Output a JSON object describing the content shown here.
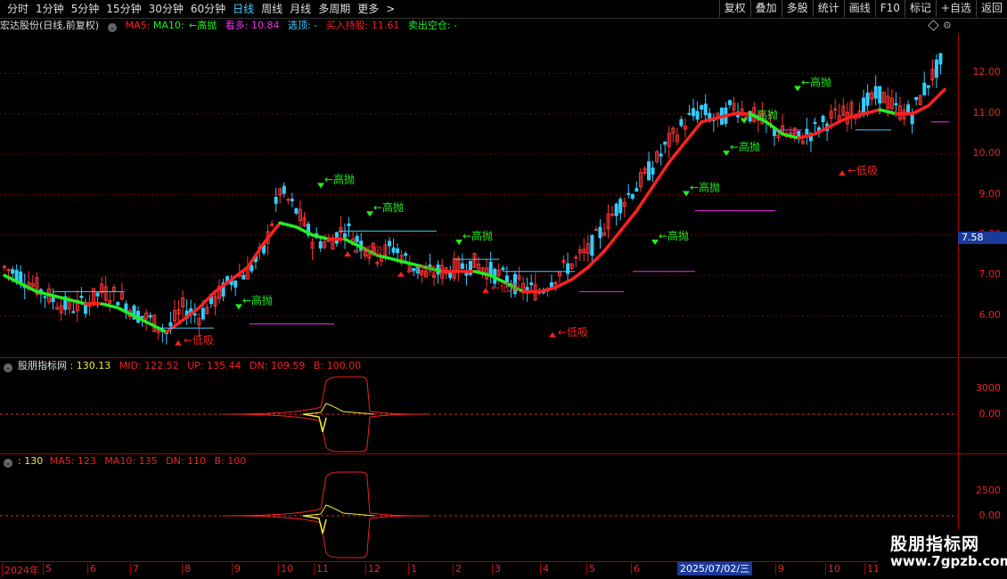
{
  "toolbar": {
    "periods": [
      "分时",
      "1分钟",
      "5分钟",
      "15分钟",
      "30分钟",
      "60分钟",
      "日线",
      "周线",
      "月线",
      "多周期",
      "更多"
    ],
    "active_period": "日线",
    "more_arrow": ">",
    "right_buttons": [
      "复权",
      "叠加",
      "多股",
      "统计",
      "画线",
      "F10",
      "标记",
      "+自选",
      "返回"
    ]
  },
  "main_legend": {
    "stock": "宏达股份(日线,前复权)",
    "ma5": "MA5:",
    "ma10": "MA10:",
    "ma10_val": "←高抛",
    "kanduo": "看多: 10.84",
    "xuanding": "选顶: -",
    "mairu": "买入持股: 11.61",
    "maichu": "卖出空仓: -"
  },
  "price_axis": {
    "ticks": [
      "12.00",
      "11.00",
      "10.00",
      "9.00",
      "8.00",
      "7.00",
      "6.00"
    ],
    "tick_values": [
      12,
      11,
      10,
      9,
      8,
      7,
      6
    ],
    "current_price": "7.58",
    "ymin": 5.0,
    "ymax": 13.0
  },
  "annotations": [
    {
      "text": "←高抛",
      "color": "#2e2",
      "x_idx": 1
    },
    {
      "text": "高抛",
      "color": "#2e2"
    },
    {
      "text": "低吸",
      "color": "#e22"
    }
  ],
  "annot_labels": {
    "high": "高抛",
    "low": "低吸",
    "high_arrow": "←高抛",
    "low_arrow": "←低吸"
  },
  "panel1": {
    "title": "股朋指标网",
    "value": ": 130.13",
    "mid": "MID: 122.52",
    "up": "UP: 135.44",
    "dn": "DN: 109.59",
    "b": "B: 100.00",
    "ticks": [
      "3000",
      "0.00"
    ]
  },
  "panel2": {
    "value": ": 130",
    "ma5": "MA5: 123",
    "ma10": "MA10: 135",
    "dn": "DN: 110",
    "b": "B: 100",
    "ticks": [
      "2500",
      "0.00"
    ]
  },
  "date_axis": {
    "labels": [
      "2024年",
      "5",
      "6",
      "7",
      "8",
      "9",
      "10",
      "11",
      "12",
      "1",
      "2",
      "3",
      "4",
      "5",
      "6",
      "",
      "8",
      "9",
      "10",
      "11"
    ],
    "cursor": "2025/07/02/三"
  },
  "watermark": {
    "title": "股朋指标网",
    "url": "www.7gpzb.com"
  },
  "colors": {
    "up": "#ff3333",
    "down": "#33ccff",
    "ma_red": "#ff2020",
    "ma_green": "#22ee22",
    "grid": "#7a0000",
    "accent": "#1a3a9a"
  },
  "chart_data": {
    "type": "line",
    "title": "",
    "series": [
      {
        "name": "close",
        "values": [
          7.2,
          7.0,
          6.7,
          6.4,
          6.2,
          6.3,
          6.6,
          6.5,
          6.1,
          5.9,
          5.6,
          6.2,
          6.0,
          6.4,
          6.9,
          7.1,
          7.6,
          9.1,
          8.6,
          7.9,
          7.8,
          8.2,
          7.8,
          7.5,
          7.7,
          7.3,
          7.0,
          7.1,
          7.2,
          7.3,
          7.1,
          6.9,
          6.7,
          6.6,
          7.0,
          7.3,
          7.6,
          8.2,
          8.8,
          9.2,
          9.7,
          10.3,
          10.8,
          11.1,
          10.8,
          11.2,
          11.0,
          10.7,
          10.5,
          10.4,
          10.6,
          10.9,
          11.0,
          11.2,
          11.5,
          11.1,
          11.0,
          11.8,
          12.4
        ]
      },
      {
        "name": "trend",
        "values": [
          7.0,
          6.8,
          6.6,
          6.5,
          6.4,
          6.3,
          6.3,
          6.2,
          6.0,
          5.8,
          5.6,
          5.9,
          6.2,
          6.6,
          6.9,
          7.2,
          7.8,
          8.3,
          8.2,
          8.0,
          7.9,
          7.9,
          7.7,
          7.5,
          7.4,
          7.3,
          7.2,
          7.1,
          7.1,
          7.1,
          7.0,
          6.8,
          6.6,
          6.6,
          6.7,
          6.9,
          7.2,
          7.6,
          8.1,
          8.6,
          9.2,
          9.8,
          10.3,
          10.8,
          10.9,
          11.0,
          11.0,
          10.8,
          10.5,
          10.4,
          10.5,
          10.7,
          10.9,
          11.0,
          11.1,
          11.0,
          11.0,
          11.2,
          11.6
        ]
      }
    ]
  }
}
